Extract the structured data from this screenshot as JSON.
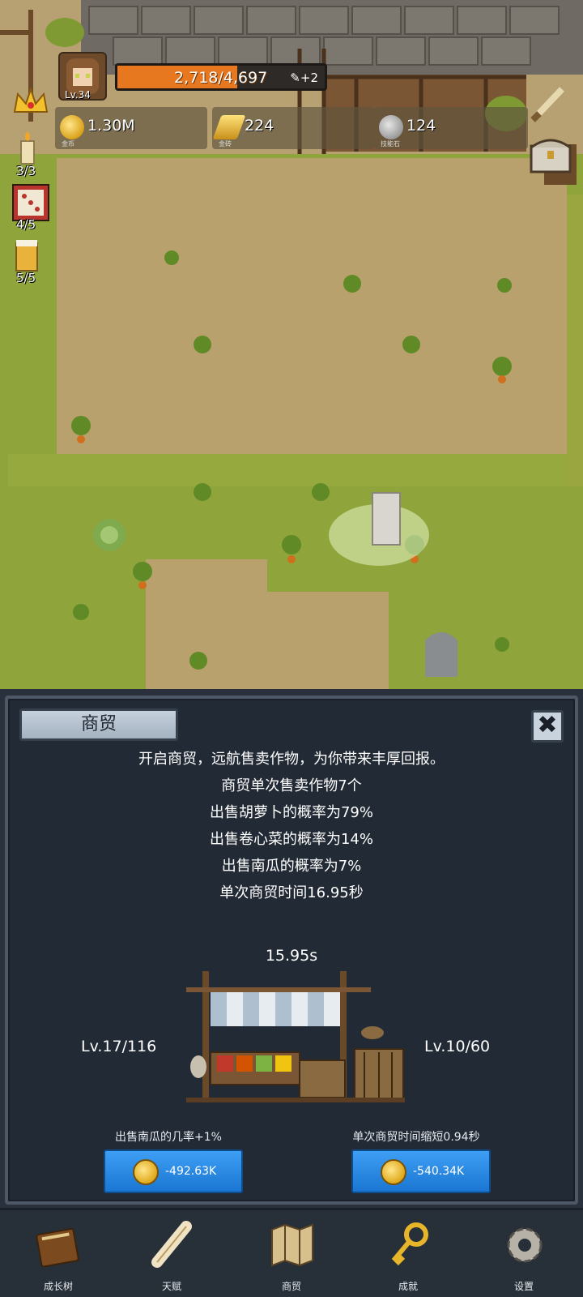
{
  "hud": {
    "level": "Lv.34",
    "xp_text": "2,718/4,697",
    "xp_progress": 0.579,
    "bonus_text": "+2",
    "resources": [
      {
        "icon": "gold-coin-icon",
        "value": "1.30M",
        "label": "金币"
      },
      {
        "icon": "gold-bar-icon",
        "value": "224",
        "label": "金砖"
      },
      {
        "icon": "skill-stone-icon",
        "value": "124",
        "label": "技能石"
      }
    ],
    "side_items": [
      {
        "icon": "candle-icon",
        "count": "3/3"
      },
      {
        "icon": "dice-icon",
        "count": "4/5"
      },
      {
        "icon": "beer-mug-icon",
        "count": "5/5"
      }
    ]
  },
  "trade_panel": {
    "title": "商贸",
    "close_symbol": "✖",
    "description": [
      "开启商贸，远航售卖作物，为你带来丰厚回报。",
      "商贸单次售卖作物7个",
      "出售胡萝卜的概率为79%",
      "出售卷心菜的概率为14%",
      "出售南瓜的概率为7%",
      "单次商贸时间16.95秒"
    ],
    "timer": "15.95s",
    "left_upgrade": {
      "level": "Lv.17/116",
      "caption": "出售南瓜的几率+1%",
      "cost": "-492.63K"
    },
    "right_upgrade": {
      "level": "Lv.10/60",
      "caption": "单次商贸时间缩短0.94秒",
      "cost": "-540.34K"
    }
  },
  "nav": [
    {
      "label": "成长树",
      "icon": "book-icon"
    },
    {
      "label": "天赋",
      "icon": "scroll-icon"
    },
    {
      "label": "商贸",
      "icon": "map-icon"
    },
    {
      "label": "成就",
      "icon": "key-icon"
    },
    {
      "label": "设置",
      "icon": "gear-icon"
    }
  ],
  "colors": {
    "xp_fill": "#e8781f",
    "button_blue": "#2a8ae6",
    "panel_bg": "#222a35"
  }
}
